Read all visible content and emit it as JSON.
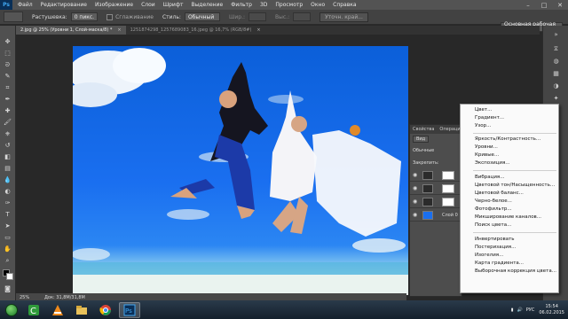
{
  "app": {
    "logo": "Ps",
    "menu": [
      "Файл",
      "Редактирование",
      "Изображение",
      "Слои",
      "Шрифт",
      "Выделение",
      "Фильтр",
      "3D",
      "Просмотр",
      "Окно",
      "Справка"
    ],
    "window_controls": [
      "–",
      "□",
      "✕"
    ]
  },
  "options": {
    "feather_label": "Растушевка:",
    "feather_value": "0 пикс.",
    "antialias_label": "Сглаживание",
    "style_label": "Стиль:",
    "style_value": "Обычный",
    "width_label": "Шир.:",
    "height_label": "Выс.:",
    "refine_button": "Уточн. край...",
    "workspace": "Основная рабочая среда"
  },
  "tabs": [
    {
      "label": "2.jpg @ 25% (Уровни 1, Слой-маска/8) *",
      "active": true
    },
    {
      "label": "1251874298_1257689083_16.jpeg @ 16,7% (RGB/8#)",
      "active": false
    }
  ],
  "status": {
    "zoom": "25%",
    "doc": "Док: 31,8M/31,8M"
  },
  "panel": {
    "tabs": [
      "Свойства",
      "Операции"
    ],
    "filter_kind": "Вид",
    "blend_mode": "Обычные",
    "lock_label": "Закрепить:",
    "layer_name": "Слой 0"
  },
  "context_menu": {
    "groups": [
      [
        "Цвет...",
        "Градиент...",
        "Узор..."
      ],
      [
        "Яркость/Контрастность...",
        "Уровни...",
        "Кривые...",
        "Экспозиция..."
      ],
      [
        "Вибрация...",
        "Цветовой тон/Насыщенность...",
        "Цветовой баланс...",
        "Черно-белое...",
        "Фотофильтр...",
        "Микширование каналов...",
        "Поиск цвета..."
      ],
      [
        "Инвертировать",
        "Постеризация...",
        "Изогелия...",
        "Карта градиента...",
        "Выборочная коррекция цвета..."
      ]
    ]
  },
  "taskbar": {
    "lang": "РУС",
    "time": "15:54",
    "date": "06.02.2015",
    "apps": [
      "camtasia-icon",
      "vlc-icon",
      "explorer-icon",
      "chrome-icon",
      "photoshop-icon"
    ]
  },
  "colors": {
    "menubar": "#535353",
    "sky": "#1a6ff0",
    "ps_blue": "#41a6f0"
  }
}
